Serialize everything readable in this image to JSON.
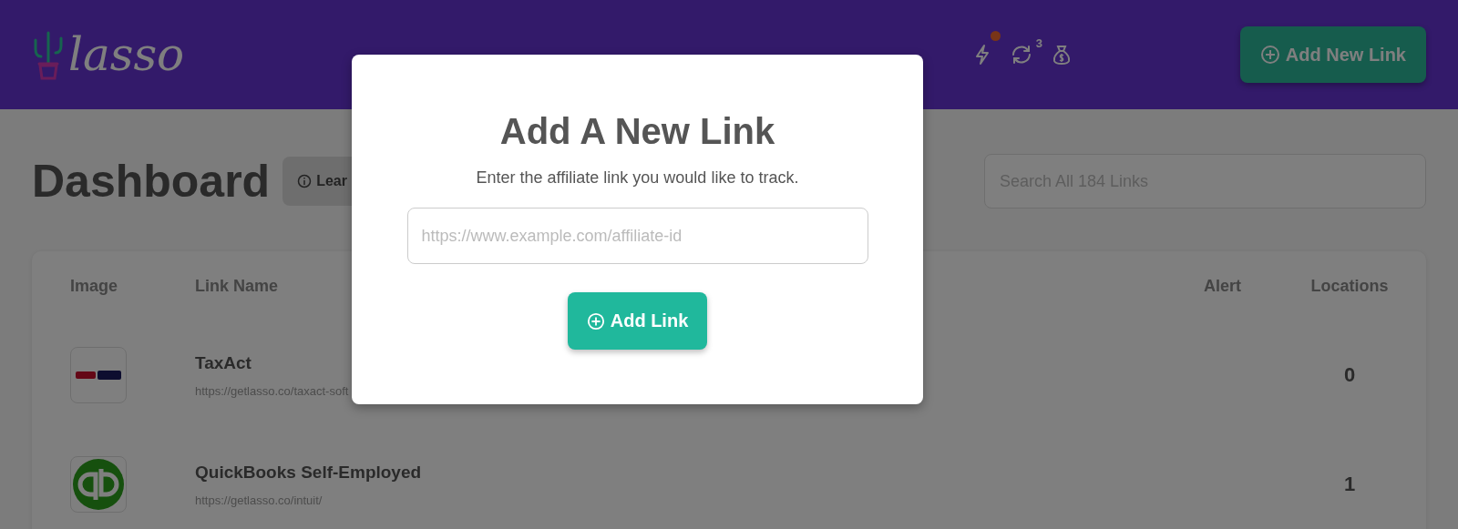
{
  "header": {
    "logo": "lasso",
    "icons": [
      {
        "kind": "bolt",
        "dot": true
      },
      {
        "kind": "sync",
        "badge": "3"
      },
      {
        "kind": "moneybag"
      }
    ],
    "add_button": "Add New Link"
  },
  "page": {
    "title": "Dashboard",
    "learn_button": "Lear",
    "search": {
      "placeholder": "Search All 184 Links"
    }
  },
  "table": {
    "columns": [
      "Image",
      "Link Name",
      "Alert",
      "Locations"
    ],
    "rows": [
      {
        "kind": "wordmark",
        "name": "TaxAct",
        "url": "https://getlasso.co/taxact-soft",
        "locations": "0"
      },
      {
        "kind": "round",
        "name": "QuickBooks Self-Employed",
        "url": "https://getlasso.co/intuit/",
        "locations": "1"
      }
    ]
  },
  "modal": {
    "title": "Add A New Link",
    "subtitle": "Enter the affiliate link you would like to track.",
    "input": {
      "placeholder": "https://www.example.com/affiliate-id"
    },
    "button": "Add Link"
  }
}
